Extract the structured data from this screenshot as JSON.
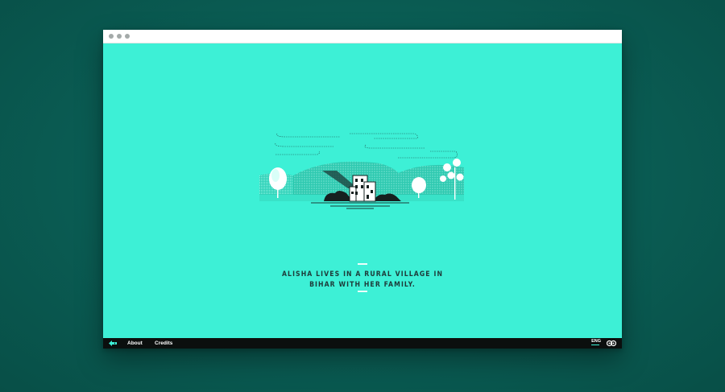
{
  "window": {
    "titlebar_dots": 3
  },
  "story": {
    "caption_line1": "Alisha lives in a rural village in",
    "caption_line2": "Bihar with her family."
  },
  "footer": {
    "back_icon": "back-arrow-icon",
    "about_label": "About",
    "credits_label": "Credits",
    "language_label": "ENG",
    "sound_icon": "sound-icon"
  },
  "colors": {
    "background": "#0a5c53",
    "viewport": "#3df0d6",
    "footer": "#0b0f0e",
    "caption": "#1e3a39"
  }
}
